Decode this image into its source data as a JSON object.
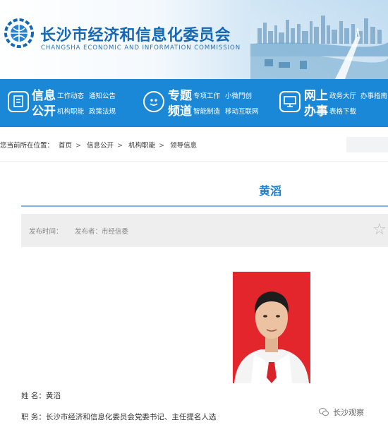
{
  "header": {
    "title": "长沙市经济和信息化委员会",
    "subtitle": "CHANGSHA ECONOMIC AND INFORMATION COMMISSION",
    "colors": {
      "brand_blue": "#1668b4",
      "nav_blue": "#1a88d6",
      "accent_title": "#1f7fcf"
    }
  },
  "nav": {
    "info": {
      "big1": "信息",
      "big2": "公开",
      "links": [
        "工作动态",
        "通知公告",
        "机构职能",
        "政策法规"
      ],
      "icon": "document-icon"
    },
    "topic": {
      "big1": "专题",
      "big2": "频道",
      "links": [
        "专项工作",
        "小微門创",
        "智能制造",
        "移动互联网"
      ],
      "icon": "smiley-icon"
    },
    "online": {
      "big1": "网上",
      "big2": "办事",
      "links": [
        "政务大厅",
        "办事指南",
        "表格下载"
      ],
      "icon": "monitor-icon"
    }
  },
  "breadcrumb": {
    "prefix": "您当前所在位置：",
    "items": [
      "首页",
      "信息公开",
      "机构职能",
      "领导信息"
    ]
  },
  "article": {
    "title": "黄滔",
    "publish_time_label": "发布时间：",
    "publisher_label": "发布者：市经信委",
    "name_label": "姓  名：",
    "name_value": "黄滔",
    "position_label": "职  务：",
    "position_value": "长沙市经济和信息化委员会党委书记、主任提名人选"
  },
  "watermark": {
    "text": "长沙观察",
    "icon": "wechat-icon"
  }
}
